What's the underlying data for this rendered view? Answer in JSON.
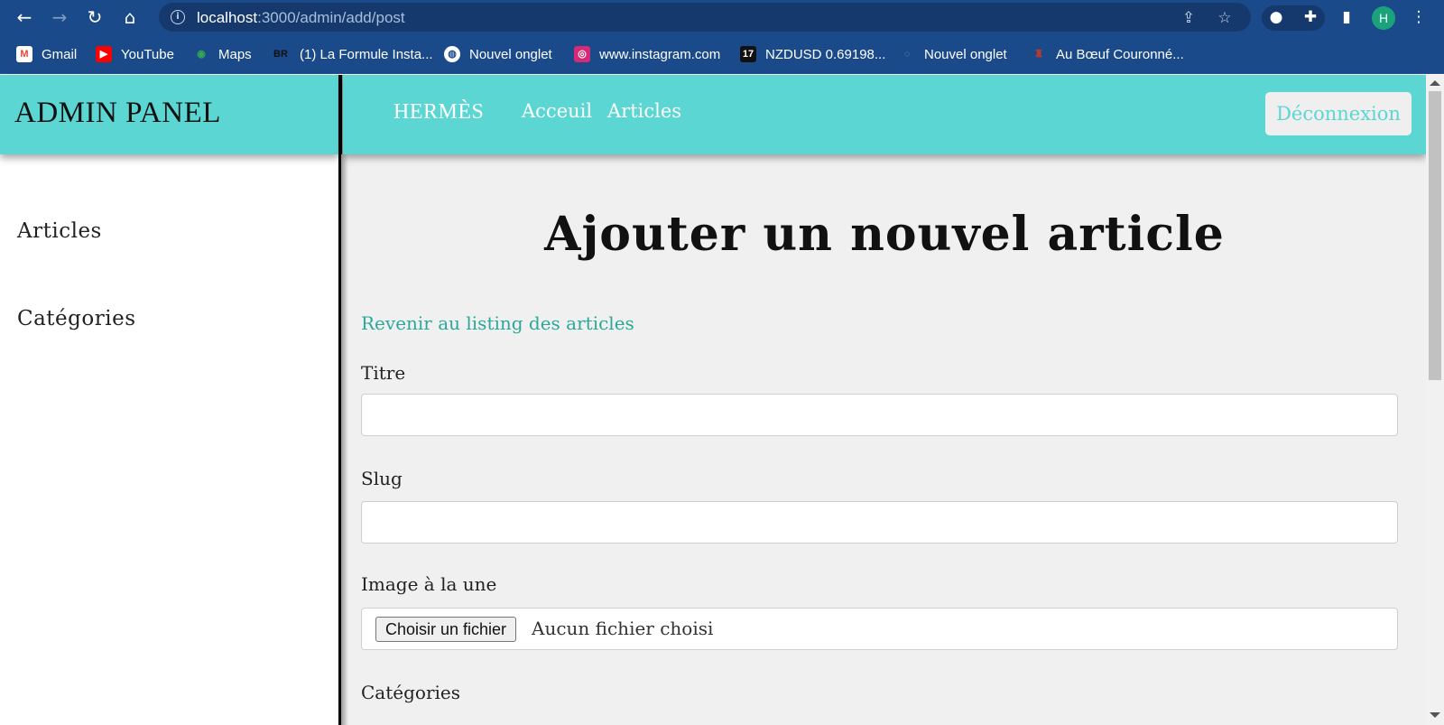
{
  "browser": {
    "url_host": "localhost",
    "url_path": ":3000/admin/add/post",
    "profile_initial": "H"
  },
  "bookmarks": [
    {
      "label": "Gmail",
      "icon": "gmail-icon",
      "color": "#ea4335"
    },
    {
      "label": "YouTube",
      "icon": "youtube-icon",
      "color": "#ff0000"
    },
    {
      "label": "Maps",
      "icon": "maps-icon",
      "color": "#34a853"
    },
    {
      "label": "(1) La Formule Insta...",
      "icon": "br-icon",
      "color": "#111111"
    },
    {
      "label": "Nouvel onglet",
      "icon": "globe-icon",
      "color": "#ffffff"
    },
    {
      "label": "www.instagram.com",
      "icon": "instagram-icon",
      "color": "#d62976"
    },
    {
      "label": "NZDUSD 0.69198...",
      "icon": "tradingview-icon",
      "color": "#111111"
    },
    {
      "label": "Nouvel onglet",
      "icon": "page-icon",
      "color": "#8899bb"
    },
    {
      "label": "Au Bœuf Couronné...",
      "icon": "restaurant-icon",
      "color": "#c0392b"
    }
  ],
  "sidebar": {
    "brand": "ADMIN PANEL",
    "items": [
      {
        "label": "Articles"
      },
      {
        "label": "Catégories"
      }
    ]
  },
  "topbar": {
    "logo": "HERMÈS",
    "links": [
      {
        "label": "Acceuil"
      },
      {
        "label": "Articles"
      }
    ],
    "logout_label": "Déconnexion"
  },
  "main": {
    "title": "Ajouter un nouvel article",
    "back_link": "Revenir au listing des articles",
    "fields": {
      "title_label": "Titre",
      "title_value": "",
      "slug_label": "Slug",
      "slug_value": "",
      "image_label": "Image à la une",
      "file_button": "Choisir un fichier",
      "file_status": "Aucun fichier choisi",
      "categories_label": "Catégories"
    }
  },
  "colors": {
    "accent": "#5bd6d3",
    "link": "#2aa99a",
    "chrome": "#1b4a8a"
  }
}
